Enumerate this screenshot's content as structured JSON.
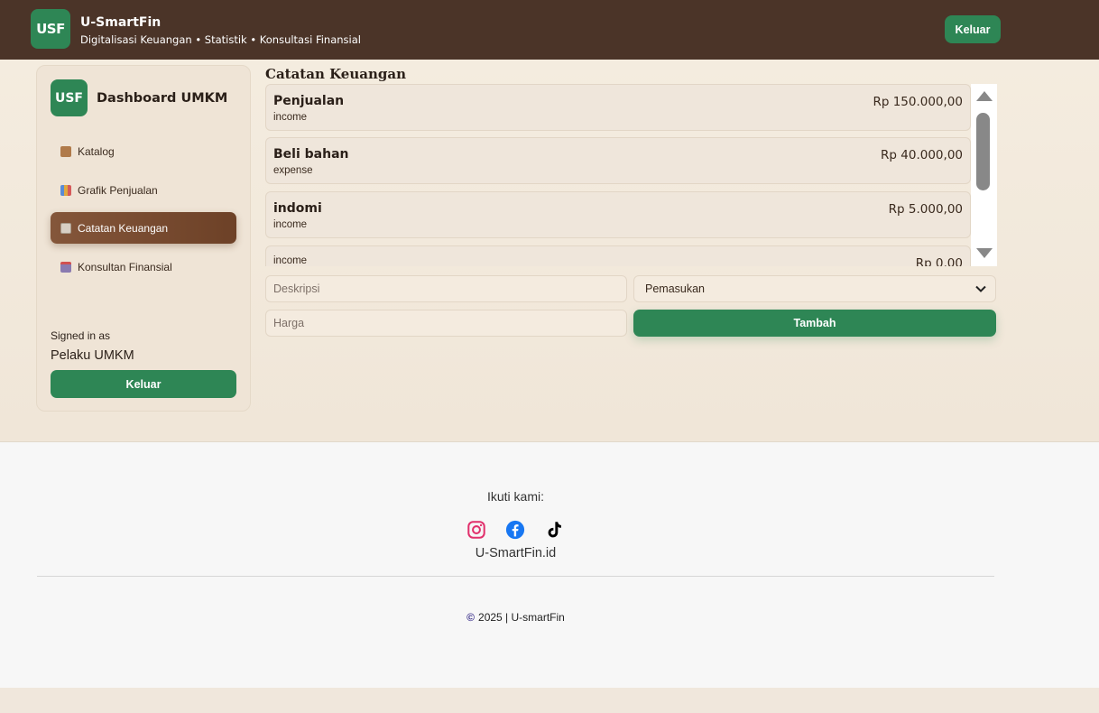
{
  "header": {
    "logo": "USF",
    "title": "U-SmartFin",
    "subtitle": "Digitalisasi Keuangan • Statistik • Konsultasi Finansial",
    "logout_label": "Keluar"
  },
  "sidebar": {
    "logo": "USF",
    "title": "Dashboard UMKM",
    "items": [
      {
        "label": "Katalog",
        "icon": "box-icon"
      },
      {
        "label": "Grafik Penjualan",
        "icon": "bar-chart-icon"
      },
      {
        "label": "Catatan Keuangan",
        "icon": "notepad-icon",
        "active": true
      },
      {
        "label": "Konsultan Finansial",
        "icon": "chat-icon"
      }
    ],
    "signed_in_label": "Signed in as",
    "user": "Pelaku UMKM",
    "logout_label": "Keluar"
  },
  "main": {
    "title": "Catatan Keuangan",
    "records": [
      {
        "description": "Penjualan",
        "type": "income",
        "amount": "Rp 150.000,00"
      },
      {
        "description": "Beli bahan",
        "type": "expense",
        "amount": "Rp 40.000,00"
      },
      {
        "description": "indomi",
        "type": "income",
        "amount": "Rp 5.000,00"
      },
      {
        "description": "",
        "type": "income",
        "amount": "Rp 0,00"
      }
    ],
    "form": {
      "description_placeholder": "Deskripsi",
      "price_placeholder": "Harga",
      "type_selected": "Pemasukan",
      "add_label": "Tambah"
    }
  },
  "footer": {
    "follow_label": "Ikuti kami:",
    "socials": [
      "instagram-icon",
      "facebook-icon",
      "tiktok-icon"
    ],
    "handle": "U-SmartFin.id",
    "copyright": "2025 | U-smartFin"
  },
  "colors": {
    "header_bg": "#4b3428",
    "accent_green": "#2e8655",
    "active_brown": "#7a4b2f",
    "page_bg": "#f0e7dc",
    "footer_bg": "#f7f7f7"
  }
}
